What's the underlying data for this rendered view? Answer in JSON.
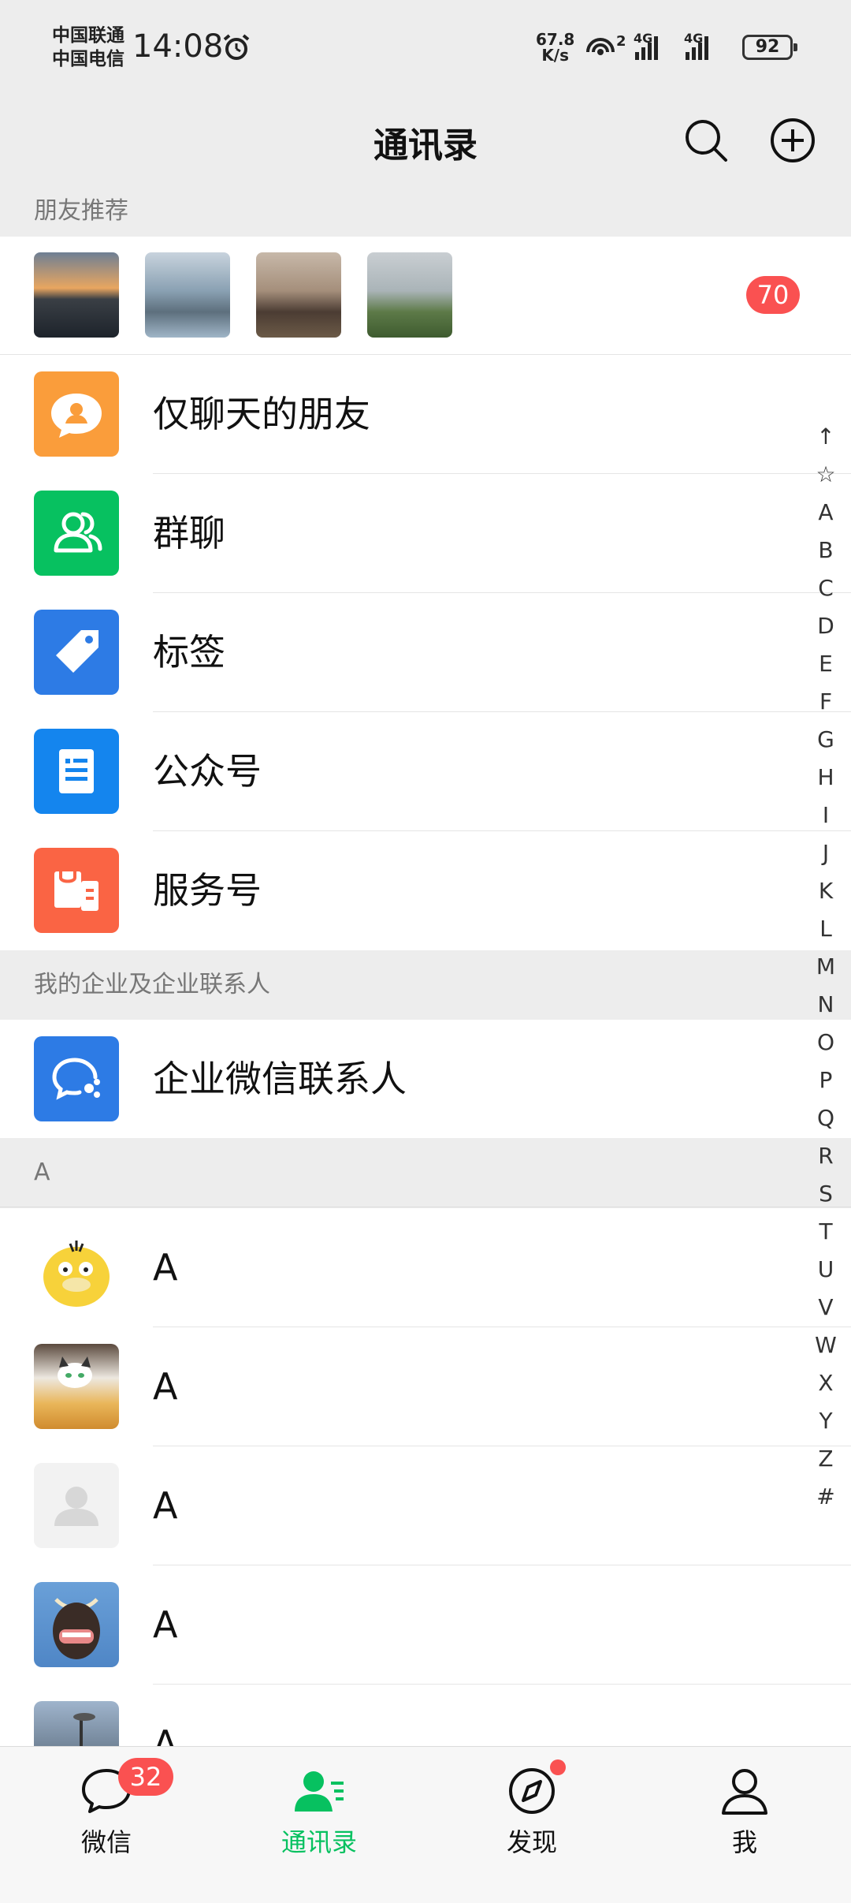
{
  "status_bar": {
    "carrier_1": "中国联通",
    "carrier_2": "中国电信",
    "time": "14:08",
    "net_speed_value": "67.8",
    "net_speed_unit": "K/s",
    "hotspot_count": "2",
    "signal_1_label": "4G",
    "signal_2_label": "4G",
    "battery": "92"
  },
  "header": {
    "title": "通讯录"
  },
  "friend_recommend": {
    "section_label": "朋友推荐",
    "badge_count": "70",
    "thumbnails": [
      "sunset-lake-photo",
      "seagulls-photo",
      "car-person-photo",
      "pagoda-hill-photo"
    ]
  },
  "function_rows": [
    {
      "label": "仅聊天的朋友",
      "icon": "chat-only-icon",
      "color": "#fa9d3b"
    },
    {
      "label": "群聊",
      "icon": "group-chat-icon",
      "color": "#07c160"
    },
    {
      "label": "标签",
      "icon": "tag-icon",
      "color": "#2d7be5"
    },
    {
      "label": "公众号",
      "icon": "official-account-icon",
      "color": "#1485ee"
    },
    {
      "label": "服务号",
      "icon": "service-account-icon",
      "color": "#fa6444"
    }
  ],
  "enterprise": {
    "section_label": "我的企业及企业联系人",
    "row_label": "企业微信联系人",
    "icon_color": "#2d7be5"
  },
  "contacts": {
    "section_label": "A",
    "items": [
      {
        "name": "A",
        "avatar": "yellow-duck-avatar"
      },
      {
        "name": "A",
        "avatar": "cat-avatar"
      },
      {
        "name": "A",
        "avatar": "default-avatar"
      },
      {
        "name": "A",
        "avatar": "yak-avatar"
      },
      {
        "name": "A",
        "avatar": "street-lamp-avatar"
      }
    ]
  },
  "index_bar": [
    "↑",
    "☆",
    "A",
    "B",
    "C",
    "D",
    "E",
    "F",
    "G",
    "H",
    "I",
    "J",
    "K",
    "L",
    "M",
    "N",
    "O",
    "P",
    "Q",
    "R",
    "S",
    "T",
    "U",
    "V",
    "W",
    "X",
    "Y",
    "Z",
    "#"
  ],
  "tabs": [
    {
      "label": "微信",
      "badge": "32"
    },
    {
      "label": "通讯录"
    },
    {
      "label": "发现"
    },
    {
      "label": "我"
    }
  ],
  "colors": {
    "accent": "#07c160",
    "badge": "#fa5151",
    "background": "#ededed"
  }
}
